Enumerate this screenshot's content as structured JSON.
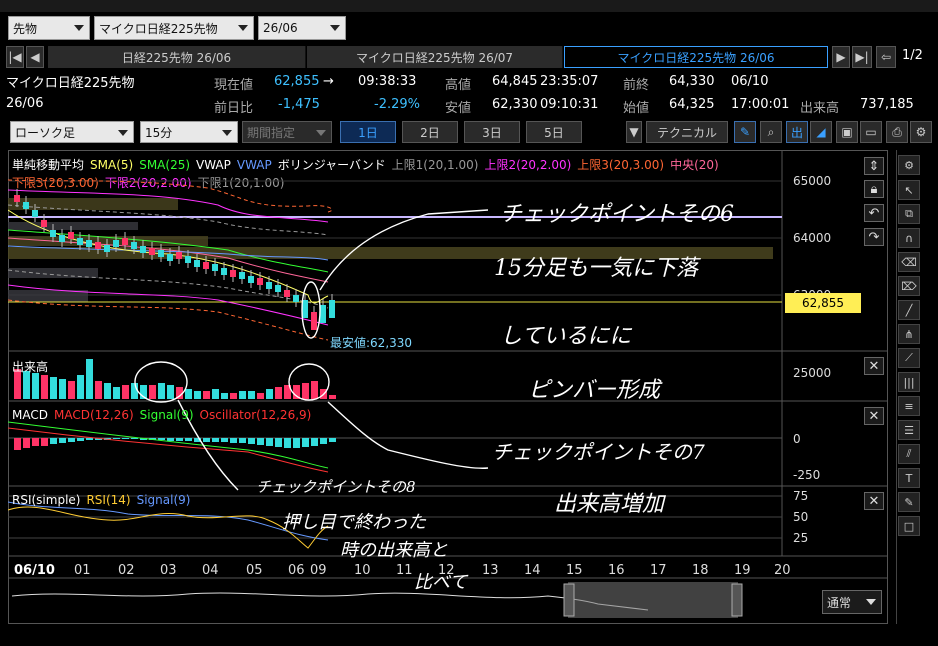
{
  "topbar": {
    "select_market": "先物",
    "select_product": "マイクロ日経225先物",
    "select_month": "26/06"
  },
  "contract_tabs": [
    "日経225先物 26/06",
    "マイクロ日経225先物 26/07",
    "マイクロ日経225先物 26/06"
  ],
  "page_indicator": "1/2",
  "quote": {
    "name": "マイクロ日経225先物",
    "month": "26/06",
    "current_label": "現在値",
    "current_value": "62,855",
    "current_arrow": "→",
    "current_time": "09:38:33",
    "high_label": "高値",
    "high_value": "64,845",
    "high_time": "23:35:07",
    "prev_close_label": "前終",
    "prev_close_value": "64,330",
    "prev_close_date": "06/10",
    "change_label": "前日比",
    "change_value": "-1,475",
    "change_pct": "-2.29%",
    "low_label": "安値",
    "low_value": "62,330",
    "low_time": "09:10:31",
    "open_label": "始値",
    "open_value": "64,325",
    "open_time": "17:00:01",
    "volume_label": "出来高",
    "volume_value": "737,185"
  },
  "toolbar": {
    "chart_type": "ローソク足",
    "interval": "15分",
    "period": "期間指定",
    "day_buttons": [
      "1日",
      "2日",
      "3日",
      "5日"
    ],
    "technical": "テクニカル",
    "out_label": "出"
  },
  "main_chart": {
    "legend_line1": [
      {
        "text": "単純移動平均",
        "color": "#ffffff"
      },
      {
        "text": "SMA(5)",
        "color": "#ffff66"
      },
      {
        "text": "SMA(25)",
        "color": "#33ff33"
      },
      {
        "text": "VWAP",
        "color": "#ffffff"
      },
      {
        "text": "VWAP",
        "color": "#6699ff"
      },
      {
        "text": "ボリンジャーバンド",
        "color": "#ffffff"
      },
      {
        "text": "上限1(20,1.00)",
        "color": "#999999"
      },
      {
        "text": "上限2(20,2.00)",
        "color": "#ff33ff"
      },
      {
        "text": "上限3(20,3.00)",
        "color": "#ff6633"
      },
      {
        "text": "中央(20)",
        "color": "#ff6699"
      }
    ],
    "legend_line2": [
      {
        "text": "下限3(20,3.00)",
        "color": "#ff6633"
      },
      {
        "text": "下限2(20,2.00)",
        "color": "#ff33ff"
      },
      {
        "text": "下限1(20,1.00)",
        "color": "#999999"
      }
    ],
    "y_ticks": [
      "65000",
      "64000",
      "63000"
    ],
    "price_tag": "62,855",
    "low_annotation": "最安値:62,330"
  },
  "volume_panel": {
    "title": "出来高",
    "y_ticks": [
      "25000"
    ]
  },
  "macd_panel": {
    "legend": [
      {
        "text": "MACD",
        "color": "#ffffff"
      },
      {
        "text": "MACD(12,26)",
        "color": "#ff3333"
      },
      {
        "text": "Signal(9)",
        "color": "#33ff33"
      },
      {
        "text": "Oscillator(12,26,9)",
        "color": "#ff3333"
      }
    ],
    "y_ticks": [
      "0",
      "-250"
    ]
  },
  "rsi_panel": {
    "legend": [
      {
        "text": "RSI(simple)",
        "color": "#ffffff"
      },
      {
        "text": "RSI(14)",
        "color": "#ffcc33"
      },
      {
        "text": "Signal(9)",
        "color": "#6699ff"
      }
    ],
    "y_ticks": [
      "75",
      "50",
      "25"
    ]
  },
  "x_axis": [
    "06/10",
    "01",
    "02",
    "03",
    "04",
    "05",
    "06",
    "09",
    "10",
    "11",
    "12",
    "13",
    "14",
    "15",
    "16",
    "17",
    "18",
    "19",
    "20"
  ],
  "bottom": {
    "mode": "通常"
  },
  "handwritten_notes": [
    "チェックポイントその6",
    "15分足も一気に下落",
    "しているにに",
    "ピンバー形成",
    "チェックポイントその7",
    "出来高増加",
    "チェックポイントその8",
    "押し目で終わった",
    "時の出来高と",
    "比べて"
  ]
}
